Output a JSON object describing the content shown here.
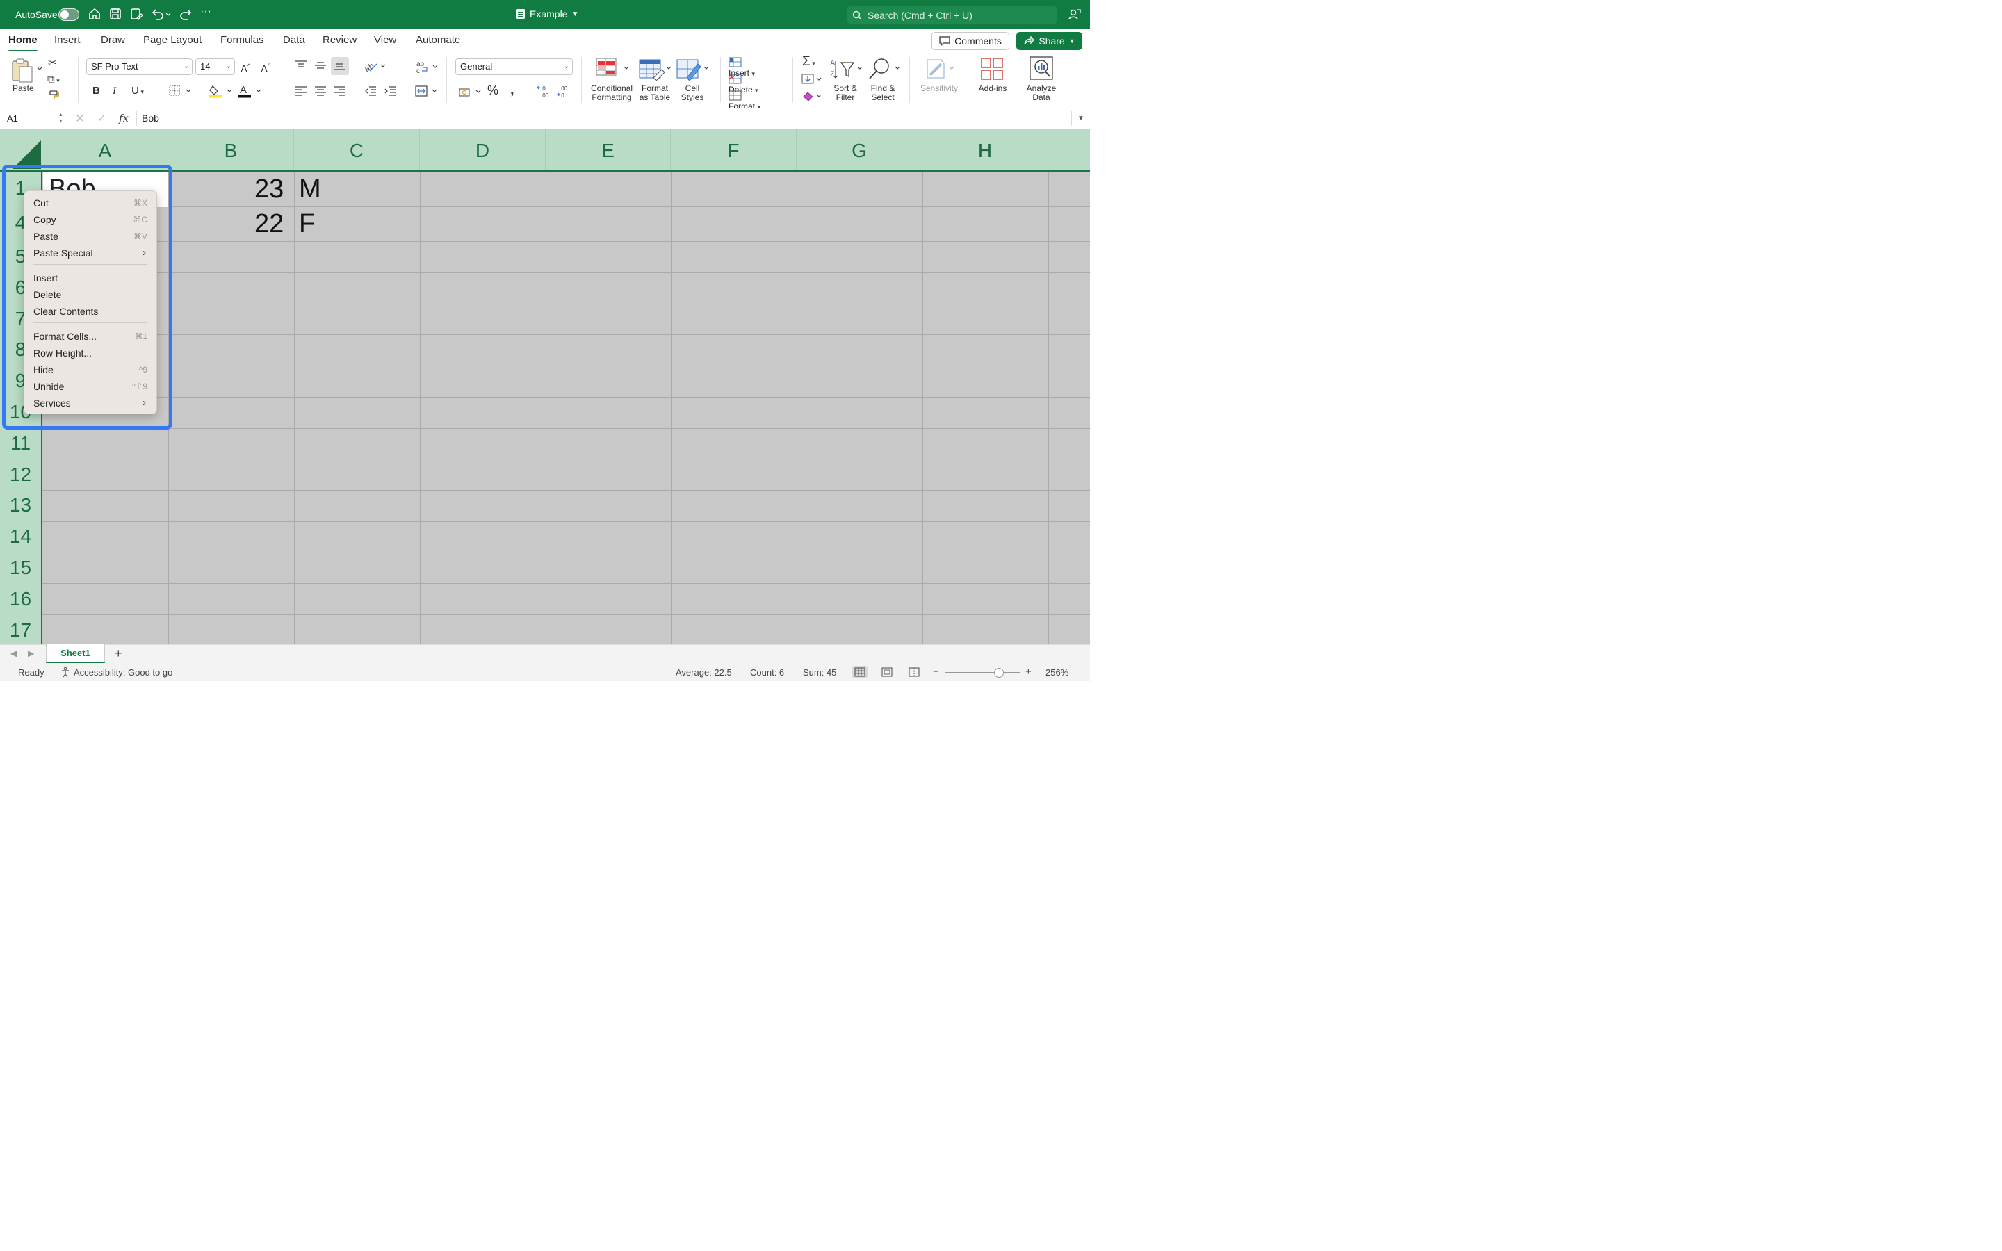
{
  "titlebar": {
    "autosave_label": "AutoSave",
    "doc_title": "Example",
    "search_placeholder": "Search (Cmd + Ctrl + U)"
  },
  "tabs": [
    "Home",
    "Insert",
    "Draw",
    "Page Layout",
    "Formulas",
    "Data",
    "Review",
    "View",
    "Automate"
  ],
  "active_tab": "Home",
  "header_buttons": {
    "comments": "Comments",
    "share": "Share"
  },
  "ribbon": {
    "paste": "Paste",
    "font_name": "SF Pro Text",
    "font_size": "14",
    "number_format": "General",
    "conditional_formatting": [
      "Conditional",
      "Formatting"
    ],
    "format_as_table": [
      "Format",
      "as Table"
    ],
    "cell_styles": [
      "Cell",
      "Styles"
    ],
    "insert": "Insert",
    "delete": "Delete",
    "format": "Format",
    "sort_filter": [
      "Sort &",
      "Filter"
    ],
    "find_select": [
      "Find &",
      "Select"
    ],
    "sensitivity": "Sensitivity",
    "add_ins": "Add-ins",
    "analyze_data": [
      "Analyze",
      "Data"
    ],
    "accent_color": "#107c41"
  },
  "formula_bar": {
    "name_box": "A1",
    "fx": "fx",
    "content": "Bob"
  },
  "columns": [
    "A",
    "B",
    "C",
    "D",
    "E",
    "F",
    "G",
    "H"
  ],
  "rows": {
    "top": [
      "1",
      "4",
      "5",
      "6",
      "7",
      "8",
      "9",
      "10"
    ],
    "bottom": [
      "11",
      "12",
      "13",
      "14",
      "15",
      "16",
      "17"
    ]
  },
  "cells": {
    "A1": "Bob",
    "B1": "23",
    "C1": "M",
    "B4": "22",
    "C4": "F"
  },
  "context_menu": {
    "items": [
      {
        "label": "Cut",
        "shortcut": "⌘X"
      },
      {
        "label": "Copy",
        "shortcut": "⌘C"
      },
      {
        "label": "Paste",
        "shortcut": "⌘V"
      },
      {
        "label": "Paste Special",
        "submenu": true
      },
      {
        "label": "Insert"
      },
      {
        "label": "Delete"
      },
      {
        "label": "Clear Contents"
      },
      {
        "label": "Format Cells...",
        "shortcut": "⌘1"
      },
      {
        "label": "Row Height..."
      },
      {
        "label": "Hide",
        "shortcut": "^9"
      },
      {
        "label": "Unhide",
        "shortcut": "^⇧9"
      },
      {
        "label": "Services",
        "submenu": true
      }
    ]
  },
  "sheet_tabs": {
    "active": "Sheet1",
    "add": "+"
  },
  "status_bar": {
    "ready": "Ready",
    "accessibility": "Accessibility: Good to go",
    "average": "Average: 22.5",
    "count": "Count: 6",
    "sum": "Sum: 45",
    "zoom": "256%"
  },
  "selection_color": "#3478f6"
}
